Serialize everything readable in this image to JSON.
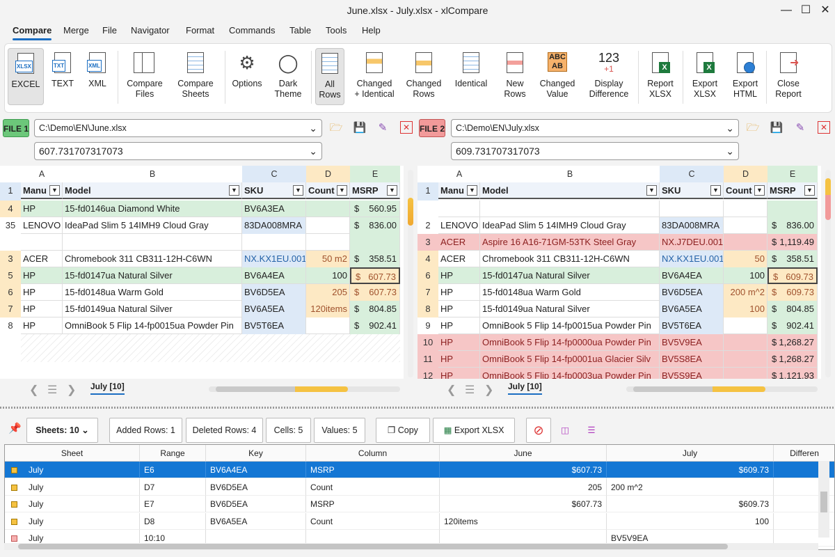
{
  "window": {
    "title": "June.xlsx - July.xlsx - xlCompare"
  },
  "menu": [
    "Compare",
    "Merge",
    "File",
    "Navigator",
    "Format",
    "Commands",
    "Table",
    "Tools",
    "Help"
  ],
  "ribbon": {
    "excel": "EXCEL",
    "text": "TEXT",
    "xml": "XML",
    "compare_files": [
      "Compare",
      "Files"
    ],
    "compare_sheets": [
      "Compare",
      "Sheets"
    ],
    "options": "Options",
    "dark_theme": [
      "Dark",
      "Theme"
    ],
    "all_rows": [
      "All",
      "Rows"
    ],
    "changed_identical": [
      "Changed",
      "+ Identical"
    ],
    "changed_rows": [
      "Changed",
      "Rows"
    ],
    "identical": "Identical",
    "new_rows": [
      "New",
      "Rows"
    ],
    "changed_value": [
      "Changed",
      "Value"
    ],
    "display_difference": [
      "Display",
      "Difference"
    ],
    "display_icon": "123",
    "display_icon2": "+1",
    "report_xlsx": [
      "Report",
      "XLSX"
    ],
    "export_xlsx": [
      "Export",
      "XLSX"
    ],
    "export_html": [
      "Export",
      "HTML"
    ],
    "close_report": [
      "Close",
      "Report"
    ]
  },
  "file1": {
    "label": "FILE 1",
    "path": "C:\\Demo\\EN\\June.xlsx",
    "value": "607.731707317073"
  },
  "file2": {
    "label": "FILE 2",
    "path": "C:\\Demo\\EN\\July.xlsx",
    "value": "609.731707317073"
  },
  "columns": [
    "A",
    "B",
    "C",
    "D",
    "E"
  ],
  "headers": [
    "Manu",
    "Model",
    "SKU",
    "Count",
    "MSRP"
  ],
  "grid1": {
    "sheet": "July [10]",
    "rows": [
      {
        "n": "4",
        "cells": [
          "HP",
          "15-fd0146ua Diamond White",
          "BV6A3EA",
          "",
          "$",
          "560.95"
        ]
      },
      {
        "n": "35",
        "cells": [
          "LENOVO",
          "IdeaPad Slim 5 14IMH9 Cloud Gray",
          "83DA008MRA",
          "",
          "$",
          "836.00"
        ]
      },
      {
        "n": "",
        "cells": [
          "",
          "",
          "",
          "",
          "",
          ""
        ]
      },
      {
        "n": "3",
        "cells": [
          "ACER",
          "Chromebook 311 CB311-12H-C6WN",
          "NX.KX1EU.001",
          "50 m2",
          "$",
          "358.51"
        ]
      },
      {
        "n": "5",
        "cells": [
          "HP",
          "15-fd0147ua Natural Silver",
          "BV6A4EA",
          "100",
          "$",
          "607.73"
        ]
      },
      {
        "n": "6",
        "cells": [
          "HP",
          "15-fd0148ua Warm Gold",
          "BV6D5EA",
          "205",
          "$",
          "607.73"
        ]
      },
      {
        "n": "7",
        "cells": [
          "HP",
          "15-fd0149ua Natural Silver",
          "BV6A5EA",
          "120items",
          "$",
          "804.85"
        ]
      },
      {
        "n": "8",
        "cells": [
          "HP",
          "OmniBook 5 Flip 14-fp0015ua Powder Pin",
          "BV5T6EA",
          "",
          "$",
          "902.41"
        ]
      }
    ]
  },
  "grid2": {
    "sheet": "July [10]",
    "rows": [
      {
        "n": "",
        "cells": [
          "",
          "",
          "",
          "",
          "",
          ""
        ]
      },
      {
        "n": "2",
        "cells": [
          "LENOVO",
          "IdeaPad Slim 5 14IMH9 Cloud Gray",
          "83DA008MRA",
          "",
          "$",
          "836.00"
        ]
      },
      {
        "n": "3",
        "cells": [
          "ACER",
          "Aspire 16 A16-71GM-53TK Steel Gray",
          "NX.J7DEU.001",
          "",
          "$",
          "1,119.49"
        ]
      },
      {
        "n": "4",
        "cells": [
          "ACER",
          "Chromebook 311 CB311-12H-C6WN",
          "NX.KX1EU.001",
          "50",
          "$",
          "358.51"
        ]
      },
      {
        "n": "6",
        "cells": [
          "HP",
          "15-fd0147ua Natural Silver",
          "BV6A4EA",
          "100",
          "$",
          "609.73"
        ]
      },
      {
        "n": "7",
        "cells": [
          "HP",
          "15-fd0148ua Warm Gold",
          "BV6D5EA",
          "200 m^2",
          "$",
          "609.73"
        ]
      },
      {
        "n": "8",
        "cells": [
          "HP",
          "15-fd0149ua Natural Silver",
          "BV6A5EA",
          "100",
          "$",
          "804.85"
        ]
      },
      {
        "n": "9",
        "cells": [
          "HP",
          "OmniBook 5 Flip 14-fp0015ua Powder Pin",
          "BV5T6EA",
          "",
          "$",
          "902.41"
        ]
      },
      {
        "n": "10",
        "cells": [
          "HP",
          "OmniBook 5 Flip 14-fp0000ua Powder Pin",
          "BV5V9EA",
          "",
          "$",
          "1,268.27"
        ]
      },
      {
        "n": "11",
        "cells": [
          "HP",
          "OmniBook 5 Flip 14-fp0001ua Glacier Silv",
          "BV5S8EA",
          "",
          "$",
          "1,268.27"
        ]
      },
      {
        "n": "12",
        "cells": [
          "HP",
          "OmniBook 5 Flip 14-fp0003ua Powder Pin",
          "BV5S9EA",
          "",
          "$",
          "1,121.93"
        ]
      }
    ]
  },
  "panel": {
    "sheets": "Sheets: 10",
    "added": "Added Rows: 1",
    "deleted": "Deleted Rows: 4",
    "cells": "Cells: 5",
    "values": "Values: 5",
    "copy": "Copy",
    "export": "Export XLSX"
  },
  "results": {
    "headers": [
      "Sheet",
      "Range",
      "Key",
      "Column",
      "June",
      "July",
      "Differen"
    ],
    "rows": [
      [
        "July",
        "E6",
        "BV6A4EA",
        "MSRP",
        "$607.73",
        "$609.73",
        ""
      ],
      [
        "July",
        "D7",
        "BV6D5EA",
        "Count",
        "205",
        "200 m^2",
        ""
      ],
      [
        "July",
        "E7",
        "BV6D5EA",
        "MSRP",
        "$607.73",
        "$609.73",
        ""
      ],
      [
        "July",
        "D8",
        "BV6A5EA",
        "Count",
        "120items",
        "100",
        ""
      ],
      [
        "July",
        "10:10",
        "",
        "",
        "",
        "BV5V9EA",
        ""
      ]
    ]
  },
  "colors": {
    "accent": "#1b6ec2",
    "file1": "#6cc77a",
    "file2": "#f29a9a",
    "changed": "#fde9c4",
    "added": "#f6c6c6",
    "same": "#d8efdc",
    "key": "#dde9f7"
  }
}
